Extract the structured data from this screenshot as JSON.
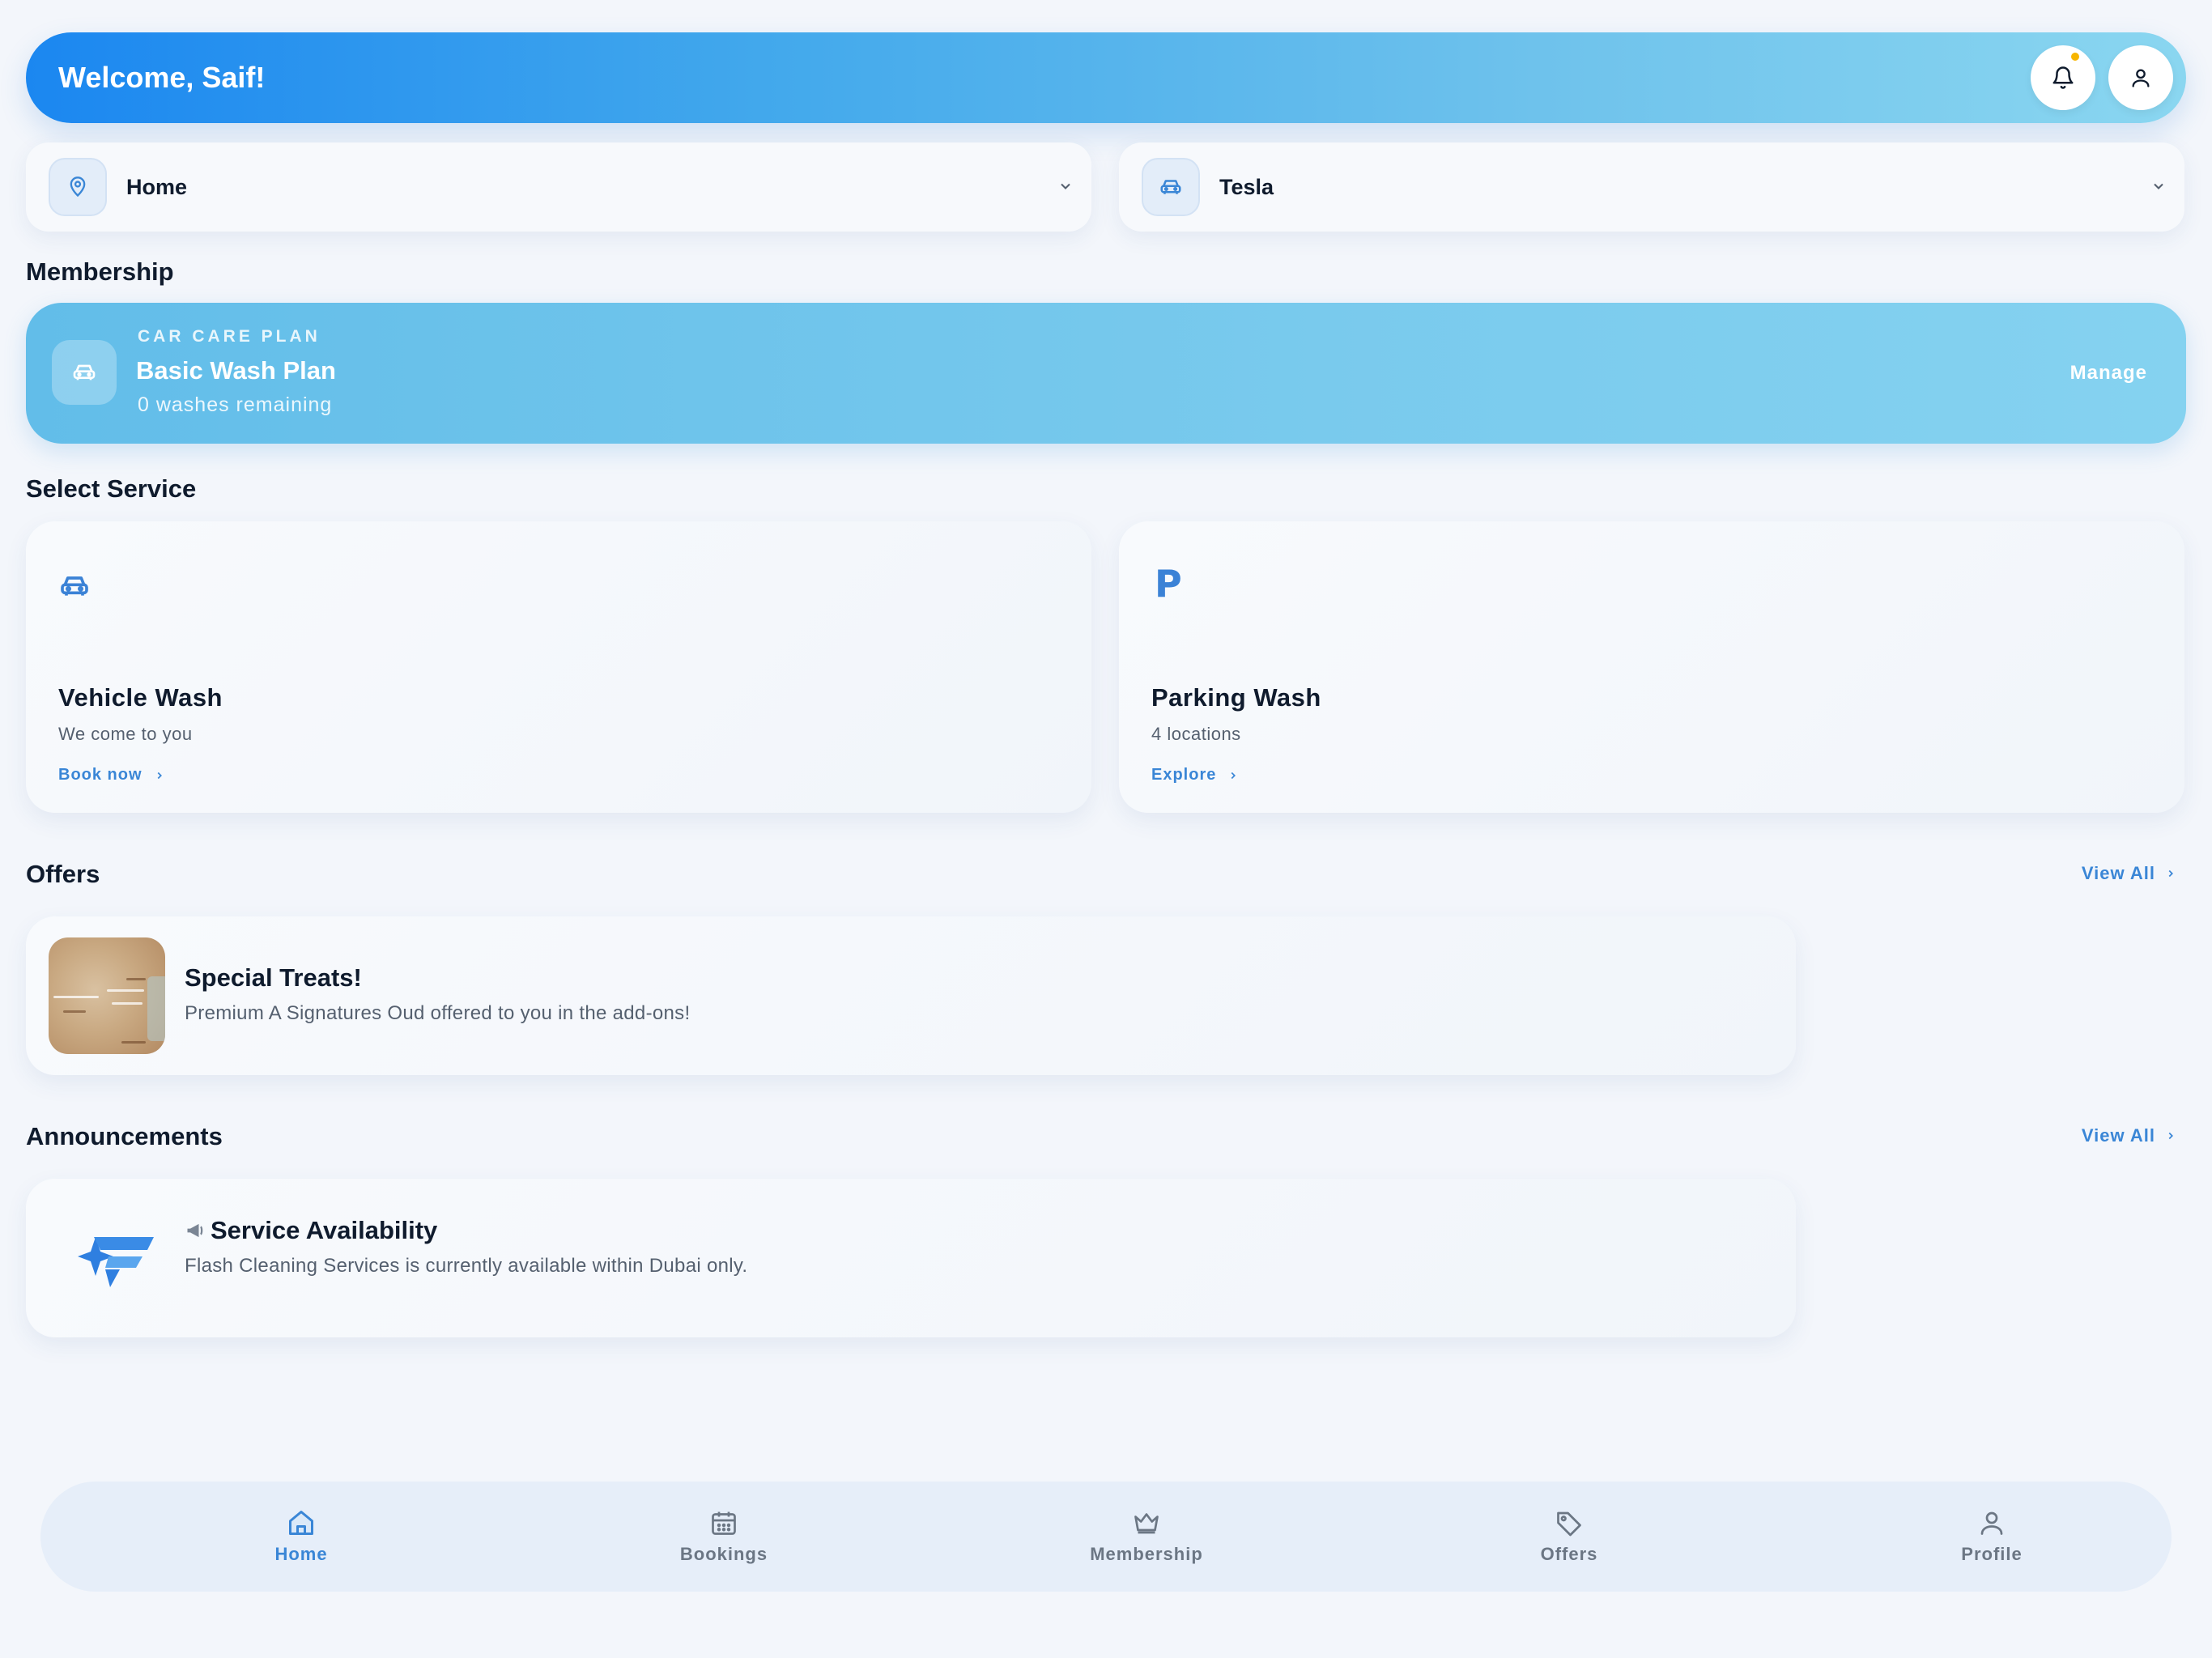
{
  "header": {
    "title": "Welcome, Saif!",
    "notification_icon": "bell-icon",
    "profile_icon": "user-icon",
    "accent_dot_color": "#f7b500"
  },
  "selectors": {
    "location": {
      "label": "Home",
      "icon": "location-pin-icon"
    },
    "vehicle": {
      "label": "Tesla",
      "icon": "car-icon"
    }
  },
  "membership": {
    "section_title": "Membership",
    "kicker": "CAR CARE PLAN",
    "plan_name": "Basic Wash Plan",
    "remaining": "0 washes remaining",
    "manage_label": "Manage"
  },
  "services": {
    "section_title": "Select Service",
    "items": [
      {
        "title": "Vehicle Wash",
        "subtitle": "We come to you",
        "link": "Book now",
        "icon": "car-icon"
      },
      {
        "title": "Parking Wash",
        "subtitle": "4 locations",
        "link": "Explore",
        "icon_text": "P"
      }
    ]
  },
  "offers": {
    "section_title": "Offers",
    "view_all": "View All",
    "items": [
      {
        "title": "Special Treats!",
        "description": "Premium A Signatures Oud offered to you in the add-ons!"
      }
    ]
  },
  "announcements": {
    "section_title": "Announcements",
    "view_all": "View All",
    "items": [
      {
        "title": "Service Availability",
        "description": "Flash Cleaning Services is currently available within Dubai only.",
        "icon": "megaphone-icon"
      }
    ]
  },
  "nav": {
    "items": [
      {
        "label": "Home",
        "icon": "home-icon",
        "active": true
      },
      {
        "label": "Bookings",
        "icon": "calendar-icon",
        "active": false
      },
      {
        "label": "Membership",
        "icon": "crown-icon",
        "active": false
      },
      {
        "label": "Offers",
        "icon": "tag-icon",
        "active": false
      },
      {
        "label": "Profile",
        "icon": "user-icon",
        "active": false
      }
    ]
  },
  "colors": {
    "accent": "#3a86d6",
    "header_gradient_start": "#1b87f0",
    "header_gradient_end": "#8ad6f0",
    "background": "#f3f6fb"
  }
}
